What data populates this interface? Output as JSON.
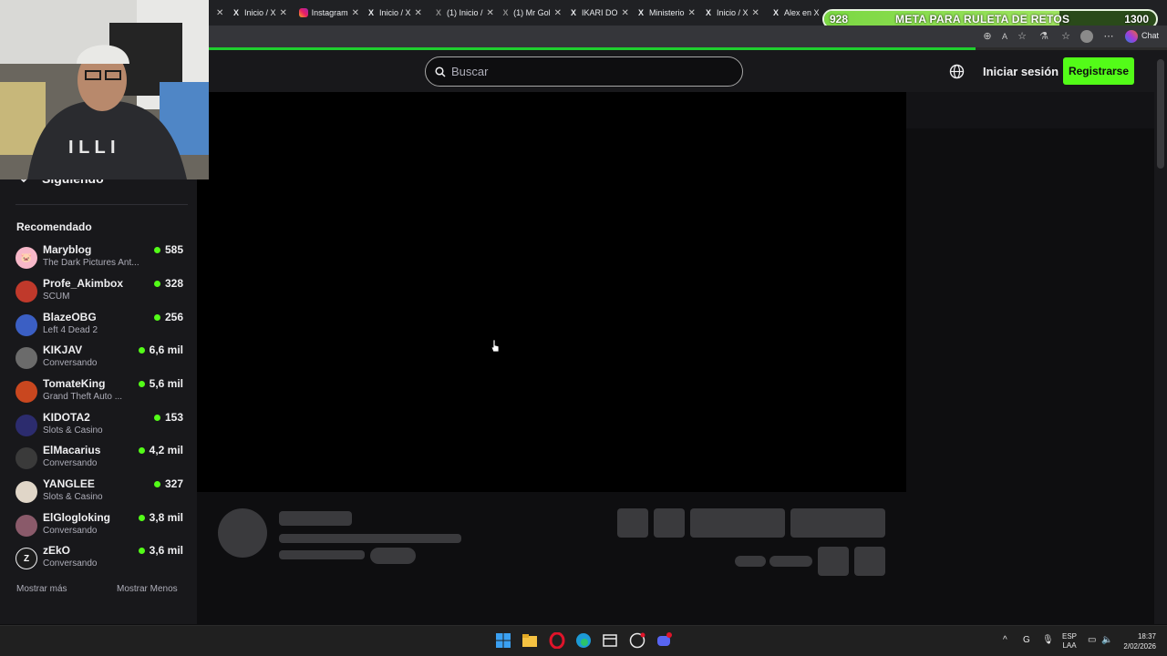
{
  "browser": {
    "tabs": [
      {
        "icon": "x-logo-icon",
        "title": "Inicio / X"
      },
      {
        "icon": "instagram-icon",
        "title": "Instagram"
      },
      {
        "icon": "x-logo-icon",
        "title": "Inicio / X"
      },
      {
        "icon": "x-logo-icon",
        "title": "(1) Inicio /"
      },
      {
        "icon": "x-logo-icon",
        "title": "(1) Mr Gol"
      },
      {
        "icon": "x-logo-icon",
        "title": "IKARI DO"
      },
      {
        "icon": "x-logo-icon",
        "title": "Ministerio"
      },
      {
        "icon": "x-logo-icon",
        "title": "Inicio / X"
      },
      {
        "icon": "x-logo-icon",
        "title": "Alex en X"
      }
    ],
    "chat_label": "Chat"
  },
  "overlay": {
    "goal_current": "928",
    "goal_title": "META PARA RULETA DE RETOS",
    "goal_target": "1300",
    "goal_progress": 0.71
  },
  "header": {
    "search_placeholder": "Buscar",
    "login_label": "Iniciar sesión",
    "register_label": "Registrarse"
  },
  "sidebar": {
    "following_label": "Siguiendo",
    "recommended_title": "Recomendado",
    "channels": [
      {
        "name": "Maryblog",
        "category": "The Dark Pictures Ant...",
        "viewers": "585",
        "avatar_color": "#f7b8c9"
      },
      {
        "name": "Profe_Akimbox",
        "category": "SCUM",
        "viewers": "328",
        "avatar_color": "#c0392b"
      },
      {
        "name": "BlazeOBG",
        "category": "Left 4 Dead 2",
        "viewers": "256",
        "avatar_color": "#3b5fc4"
      },
      {
        "name": "KIKJAV",
        "category": "Conversando",
        "viewers": "6,6 mil",
        "avatar_color": "#6b6b6b"
      },
      {
        "name": "TomateKing",
        "category": "Grand Theft Auto ...",
        "viewers": "5,6 mil",
        "avatar_color": "#c9471f"
      },
      {
        "name": "KIDOTA2",
        "category": "Slots & Casino",
        "viewers": "153",
        "avatar_color": "#2c2c6e"
      },
      {
        "name": "ElMacarius",
        "category": "Conversando",
        "viewers": "4,2 mil",
        "avatar_color": "#3a3a3a"
      },
      {
        "name": "YANGLEE",
        "category": "Slots & Casino",
        "viewers": "327",
        "avatar_color": "#e0d6c8"
      },
      {
        "name": "ElGlogloking",
        "category": "Conversando",
        "viewers": "3,8 mil",
        "avatar_color": "#8a5a6a"
      },
      {
        "name": "zEkO",
        "category": "Conversando",
        "viewers": "3,6 mil",
        "avatar_color": "#1c1c1c"
      }
    ],
    "show_more_label": "Mostrar más",
    "show_less_label": "Mostrar Menos"
  },
  "taskbar": {
    "lang_top": "ESP",
    "lang_bottom": "LAA",
    "time": "18:37",
    "date": "2/02/2026"
  }
}
